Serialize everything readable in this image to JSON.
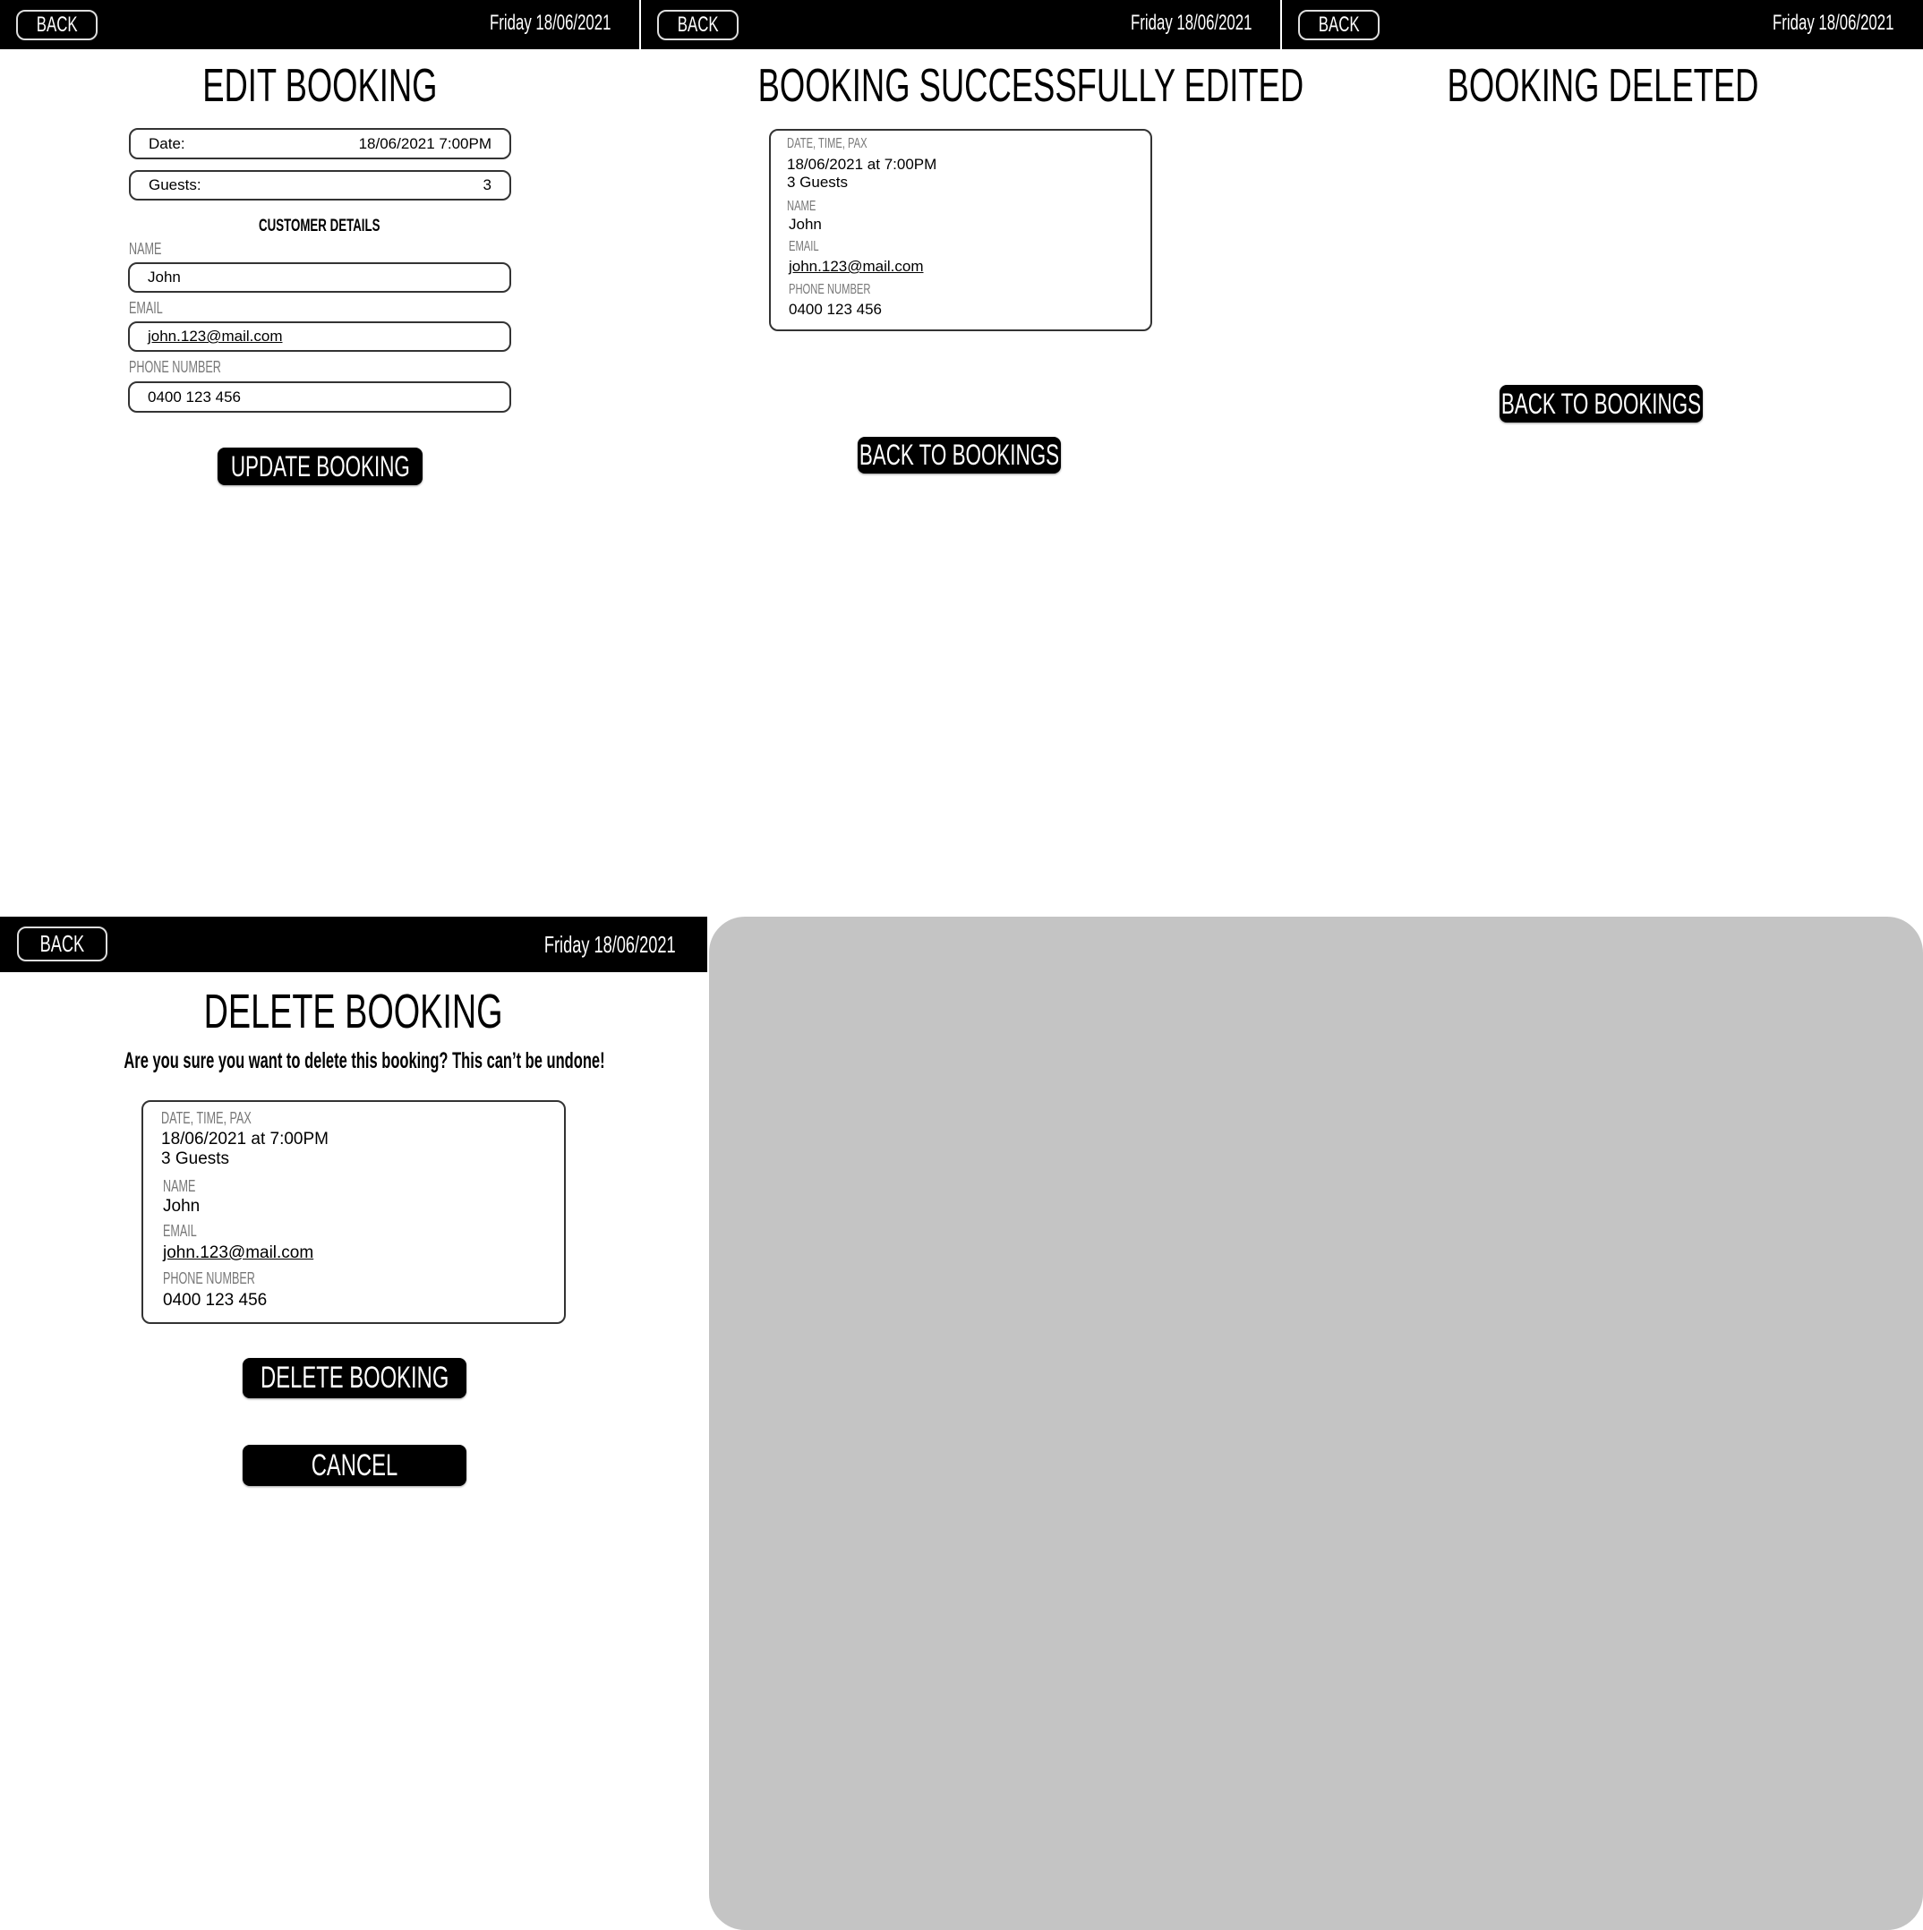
{
  "header": {
    "back_label": "BACK",
    "date": "Friday 18/06/2021"
  },
  "edit_screen": {
    "title": "EDIT BOOKING",
    "date_label": "Date:",
    "date_value": "18/06/2021 7:00PM",
    "guests_label": "Guests:",
    "guests_value": "3",
    "section_title": "CUSTOMER DETAILS",
    "name_label": "NAME",
    "name_value": "John",
    "email_label": "EMAIL",
    "email_value": "john.123@mail.com",
    "phone_label": "PHONE NUMBER",
    "phone_value": "0400 123 456",
    "submit_label": "UPDATE BOOKING"
  },
  "edited_screen": {
    "title": "BOOKING SUCCESSFULLY EDITED",
    "back_to_bookings_label": "BACK TO BOOKINGS"
  },
  "deleted_screen": {
    "title": "BOOKING DELETED",
    "back_to_bookings_label": "BACK TO BOOKINGS"
  },
  "delete_screen": {
    "title": "DELETE BOOKING",
    "question": "Are you sure you want to delete this booking? This can’t be undone!",
    "delete_label": "DELETE BOOKING",
    "cancel_label": "CANCEL"
  },
  "booking": {
    "dtp_label": "DATE, TIME, PAX",
    "datetime": "18/06/2021 at 7:00PM",
    "guests": "3 Guests",
    "name_label": "NAME",
    "name": "John",
    "email_label": "EMAIL",
    "email": "john.123@mail.com",
    "phone_label": "PHONE NUMBER",
    "phone": "0400 123 456"
  },
  "colors": {
    "header": "#000000",
    "placeholder_area": "#c4c4c4",
    "label": "#777777"
  }
}
